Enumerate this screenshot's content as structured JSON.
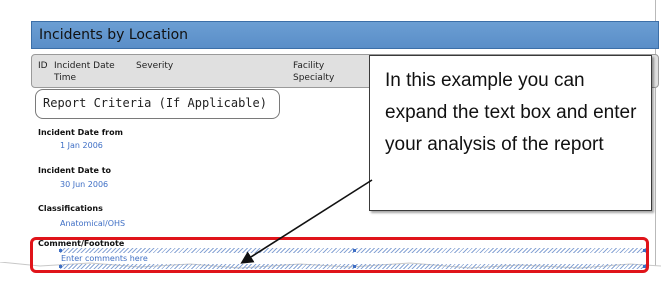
{
  "report": {
    "title": "Incidents by Location",
    "columns": [
      {
        "line1": "ID",
        "line2": ""
      },
      {
        "line1": "Incident Date",
        "line2": "Time"
      },
      {
        "line1": "Severity",
        "line2": ""
      },
      {
        "line1": "Facility",
        "line2": "Specialty"
      }
    ],
    "criteria_label": "Report Criteria (If Applicable)",
    "fields": [
      {
        "label": "Incident Date from",
        "value": "1 Jan 2006"
      },
      {
        "label": "Incident Date to",
        "value": "30 Jun 2006"
      },
      {
        "label": "Classifications",
        "value": "Anatomical/OHS"
      }
    ],
    "comment": {
      "label": "Comment/Footnote",
      "placeholder": "Enter comments here"
    }
  },
  "callout": {
    "text": "In this example you can expand the text box and enter your analysis of the report"
  },
  "colors": {
    "title_bar": "#5a8ec8",
    "highlight": "#e0141a",
    "field_value": "#3f6fc5"
  }
}
